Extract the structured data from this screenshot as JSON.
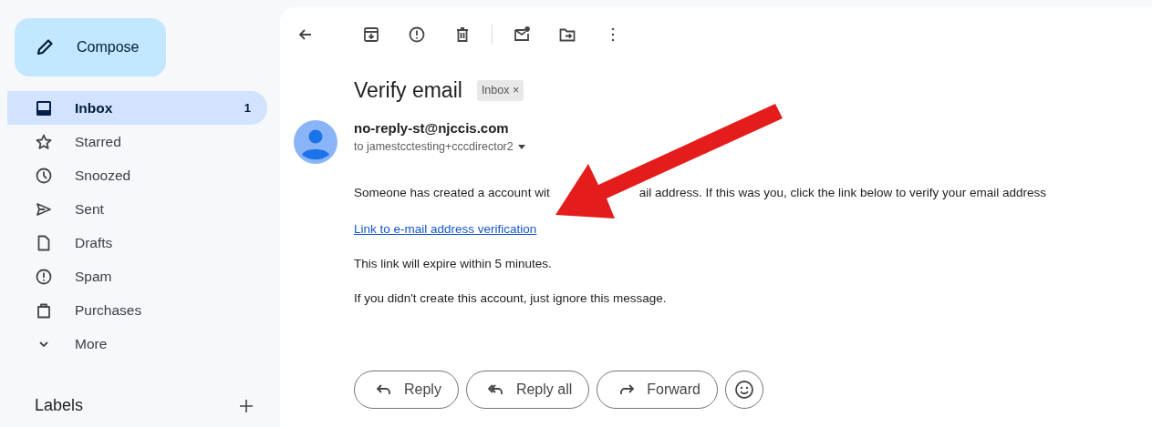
{
  "compose": {
    "label": "Compose"
  },
  "sidebar": {
    "items": [
      {
        "label": "Inbox",
        "count": "1",
        "selected": true
      },
      {
        "label": "Starred",
        "selected": false
      },
      {
        "label": "Snoozed",
        "selected": false
      },
      {
        "label": "Sent",
        "selected": false
      },
      {
        "label": "Drafts",
        "selected": false
      },
      {
        "label": "Spam",
        "selected": false
      },
      {
        "label": "Purchases",
        "selected": false
      },
      {
        "label": "More",
        "selected": false
      }
    ],
    "labels_heading": "Labels"
  },
  "message": {
    "subject": "Verify email",
    "label_chip": "Inbox",
    "chip_close": "×",
    "sender": "no-reply-st@njccis.com",
    "recipient": "to jamestcctesting+cccdirector2",
    "body": {
      "line_1_before": "Someone has created a account wit",
      "line_1_after": "ail address. If this was you, click the link below to verify your email address",
      "link": "Link to e-mail address verification",
      "paragraphs": [
        "This link will expire within 5 minutes.",
        "If you didn't create this account, just ignore this message."
      ]
    },
    "actions": [
      "Reply",
      "Reply all",
      "Forward"
    ]
  }
}
